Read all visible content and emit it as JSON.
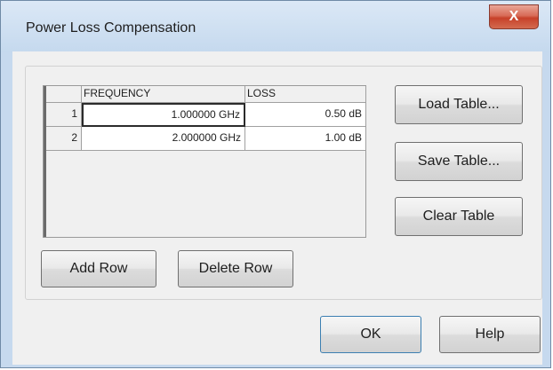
{
  "window": {
    "title": "Power Loss Compensation",
    "close_label": "X"
  },
  "table": {
    "columns": [
      "FREQUENCY",
      "LOSS"
    ],
    "rows": [
      {
        "index": "1",
        "frequency": "1.000000 GHz",
        "loss": "0.50 dB"
      },
      {
        "index": "2",
        "frequency": "2.000000 GHz",
        "loss": "1.00 dB"
      }
    ]
  },
  "side_buttons": {
    "load": "Load Table...",
    "save": "Save Table...",
    "clear": "Clear Table"
  },
  "row_buttons": {
    "add": "Add Row",
    "delete": "Delete Row"
  },
  "dialog_buttons": {
    "ok": "OK",
    "help": "Help"
  }
}
